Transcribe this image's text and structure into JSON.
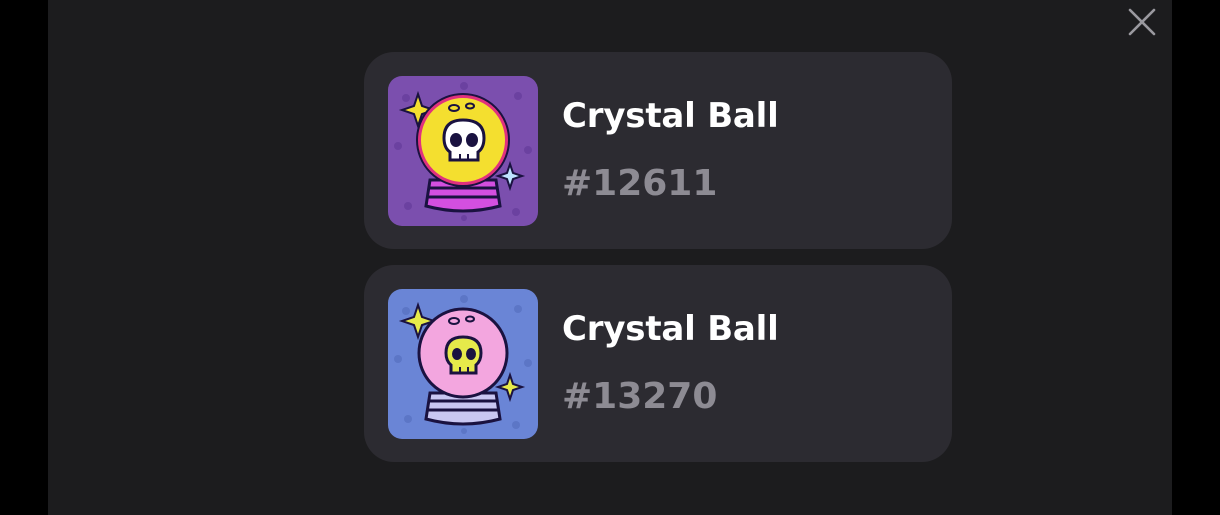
{
  "colors": {
    "backdrop": "#000000",
    "modal_bg": "#1c1c1e",
    "card_bg": "#2c2b31",
    "title": "#ffffff",
    "token_id": "#8d8b93"
  },
  "close_icon": "close-icon",
  "items": [
    {
      "title": "Crystal Ball",
      "token_id": "#12611",
      "image_icon": "crystal-ball-skull-icon",
      "image_bg": "#7b4fae",
      "orb_color": "#f4df2f",
      "skull_color": "#ffffff"
    },
    {
      "title": "Crystal Ball",
      "token_id": "#13270",
      "image_icon": "crystal-ball-skull-icon",
      "image_bg": "#6a85d6",
      "orb_color": "#f3a6df",
      "skull_color": "#e6ea4a"
    }
  ]
}
